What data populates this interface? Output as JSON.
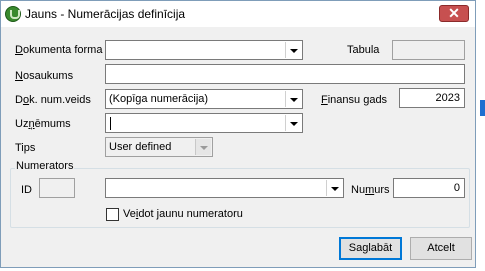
{
  "window": {
    "title": "Jauns - Numerācijas definīcija",
    "close_glyph": "✕"
  },
  "form": {
    "dokumenta_forma": {
      "label_u": "D",
      "label_rest": "okumenta forma",
      "value": ""
    },
    "tabula": {
      "label": "Tabula",
      "value": ""
    },
    "nosaukums": {
      "label_u": "N",
      "label_rest": "osaukums",
      "value": ""
    },
    "dok_num_veids": {
      "label_pre": "D",
      "label_u": "o",
      "label_rest": "k. num.veids",
      "value": "(Kopīga numerācija)"
    },
    "finansu_gads": {
      "label_u": "F",
      "label_rest": "inansu gads",
      "value": "2023"
    },
    "uznemums": {
      "label_pre": "Uz",
      "label_u": "ņ",
      "label_rest": "ēmums",
      "value": ""
    },
    "tips": {
      "label": "Tips",
      "value": "User defined"
    }
  },
  "numerators": {
    "group_title": "Numerators",
    "id_label": "ID",
    "id_value": "",
    "numerators_value": "",
    "numurs": {
      "label_pre": "Nu",
      "label_u": "m",
      "label_rest": "urs",
      "value": "0"
    },
    "checkbox": {
      "label_pre": "Ve",
      "label_u": "i",
      "label_rest": "dot jaunu numeratoru",
      "checked": false
    }
  },
  "buttons": {
    "save": {
      "label_pre": "Sa",
      "label_u": "g",
      "label_rest": "labāt"
    },
    "cancel": {
      "label": "Atcelt"
    }
  }
}
